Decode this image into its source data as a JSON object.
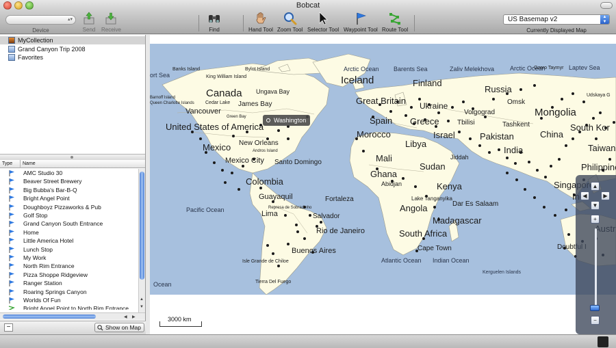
{
  "window": {
    "title": "Bobcat"
  },
  "toolbar": {
    "device_label": "Device",
    "send_label": "Send",
    "receive_label": "Receive",
    "find_label": "Find",
    "hand_tool_label": "Hand Tool",
    "zoom_tool_label": "Zoom Tool",
    "selector_tool_label": "Selector Tool",
    "waypoint_tool_label": "Waypoint Tool",
    "route_tool_label": "Route Tool",
    "map_select_value": "US Basemap v2",
    "map_select_label": "Currently Displayed Map"
  },
  "collections": [
    {
      "label": "MyCollection",
      "selected": true,
      "icon": "collection-icon"
    },
    {
      "label": "Grand Canyon Trip 2008",
      "selected": false,
      "icon": "folder-icon"
    },
    {
      "label": "Favorites",
      "selected": false,
      "icon": "folder-icon"
    }
  ],
  "list": {
    "columns": {
      "type": "Type",
      "name": "Name"
    },
    "items": [
      {
        "name": "AMC Studio 30",
        "icon": "waypoint-flag-icon"
      },
      {
        "name": "Beaver Street Brewery",
        "icon": "waypoint-flag-icon"
      },
      {
        "name": "Big Bubba's Bar-B-Q",
        "icon": "waypoint-flag-icon"
      },
      {
        "name": "Bright Angel Point",
        "icon": "waypoint-flag-icon"
      },
      {
        "name": "Doughboyz Pizzaworks & Pub",
        "icon": "waypoint-flag-icon"
      },
      {
        "name": "Golf Stop",
        "icon": "waypoint-flag-icon"
      },
      {
        "name": "Grand Canyon South Entrance",
        "icon": "waypoint-flag-icon"
      },
      {
        "name": "Home",
        "icon": "waypoint-flag-icon"
      },
      {
        "name": "Little America Hotel",
        "icon": "waypoint-flag-icon"
      },
      {
        "name": "Lunch Stop",
        "icon": "waypoint-flag-icon"
      },
      {
        "name": "My Work",
        "icon": "waypoint-flag-icon"
      },
      {
        "name": "North Rim Entrance",
        "icon": "waypoint-flag-icon"
      },
      {
        "name": "Pizza Shoppe Ridgeview",
        "icon": "waypoint-flag-icon"
      },
      {
        "name": "Ranger Station",
        "icon": "waypoint-flag-icon"
      },
      {
        "name": "Roaring Springs Canyon",
        "icon": "waypoint-flag-icon"
      },
      {
        "name": "Worlds Of Fun",
        "icon": "waypoint-flag-icon"
      },
      {
        "name": "Bright Angel Point to North Rim Entrance",
        "icon": "route-icon"
      }
    ]
  },
  "bottom": {
    "show_on_map_label": "Show on Map",
    "remove_label": "−"
  },
  "map": {
    "callout": "Washington",
    "scale": "3000 km",
    "labels": [
      "Banks Island",
      "Bylot Island",
      "Arctic Ocean",
      "Barents Sea",
      "Zaliv Melekhova",
      "Arctic Ocean",
      "Ozero Taymyr",
      "Laptev Sea",
      "ort Sea",
      "King William Island",
      "Iceland",
      "Finland",
      "Russia",
      "Udskaya G",
      "Canada",
      "Ungava Bay",
      "Great Britain",
      "Ukraine",
      "Omsk",
      "Mongolia",
      "Barnoff Island",
      "Queen Charlotte Islands",
      "Cedar Lake",
      "James Bay",
      "Green Bay",
      "Spain",
      "Volgograd",
      "Vancouver",
      "United States of America",
      "Greece",
      "Tbilisi",
      "Tashkent",
      "South Kor",
      "Morocco",
      "Israel",
      "Pakistan",
      "China",
      "Taiwan",
      "Mexico",
      "New Orleans",
      "Andros Island",
      "Libya",
      "India",
      "Mexico City",
      "Santo Domingo",
      "Mali",
      "Sudan",
      "Jiddah",
      "Philippines",
      "Colombia",
      "Ghana",
      "Abidjan",
      "Kenya",
      "Singapore",
      "Indo",
      "Guayaquil",
      "Fortaleza",
      "Angola",
      "Dar Es Salaam",
      "Lake Tanganyika",
      "Pacific Ocean",
      "Lima",
      "Represa de Sobradinho",
      "Salvador",
      "Madagascar",
      "Rio de Janeiro",
      "South Africa",
      "Austr",
      "Buenos Aires",
      "Cape Town",
      "Doubtful I",
      "Isle Grande de Chiloe",
      "Atlantic Ocean",
      "Indian Ocean",
      "Kerguelen Islands",
      "Tierra Del Fuego",
      "Ocean"
    ]
  },
  "colors": {
    "ocean": "#a7c0de",
    "land": "#fdfbe4",
    "border": "#9c9c8c",
    "selection": "#d4d4d4",
    "accent": "#3d74d6"
  }
}
